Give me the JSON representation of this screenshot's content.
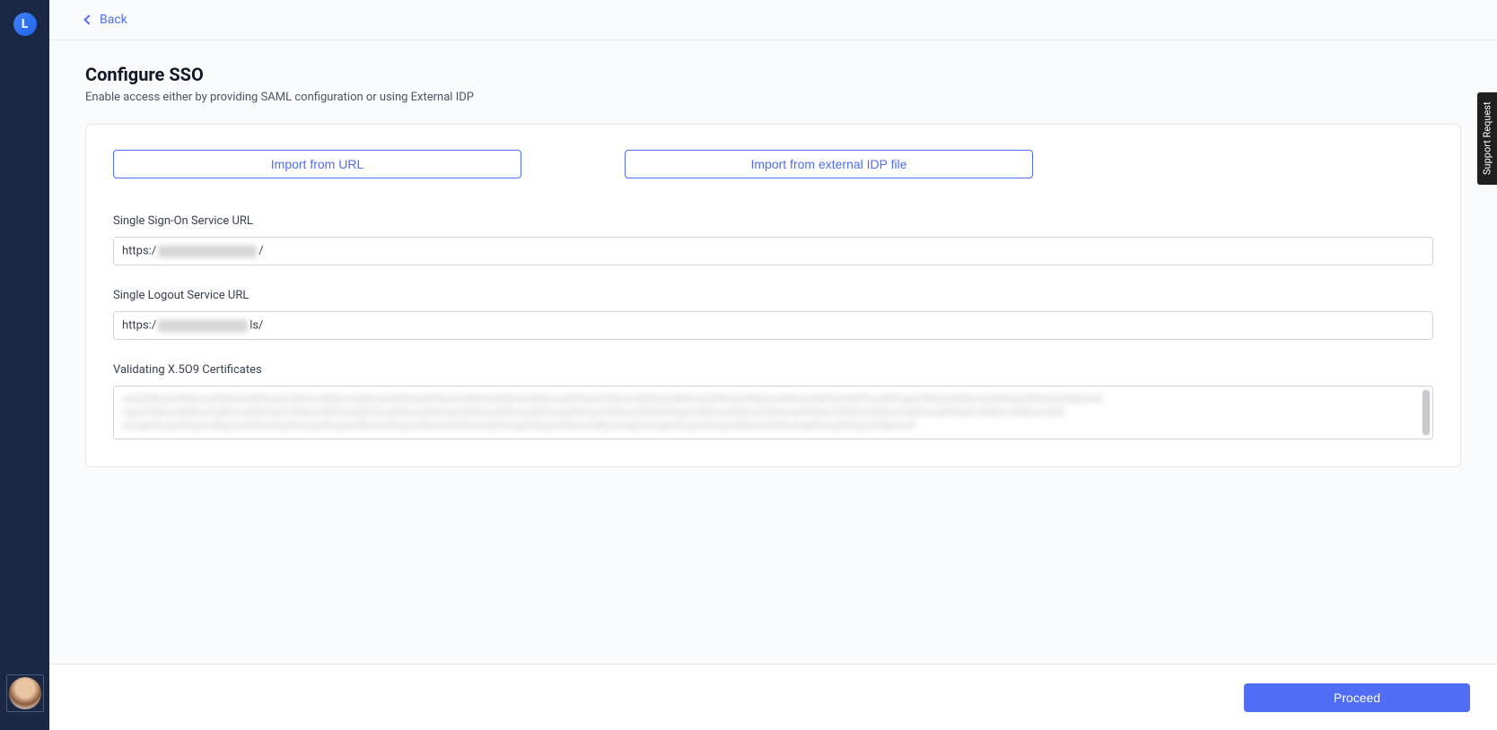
{
  "sidebar": {
    "logo_letter": "L"
  },
  "topbar": {
    "back_label": "Back"
  },
  "page": {
    "title": "Configure SSO",
    "subtitle": "Enable access either by providing SAML configuration or using External IDP"
  },
  "buttons": {
    "import_url": "Import from URL",
    "import_file": "Import from external IDP file",
    "proceed": "Proceed"
  },
  "fields": {
    "sso_url": {
      "label": "Single Sign-On Service URL",
      "prefix": "https:/",
      "suffix": "/"
    },
    "slo_url": {
      "label": "Single Logout Service URL",
      "prefix": "https:/",
      "suffix": "ls/"
    },
    "cert": {
      "label": "Validating X.5O9 Certificates"
    }
  },
  "support": {
    "label": "Support Request"
  }
}
